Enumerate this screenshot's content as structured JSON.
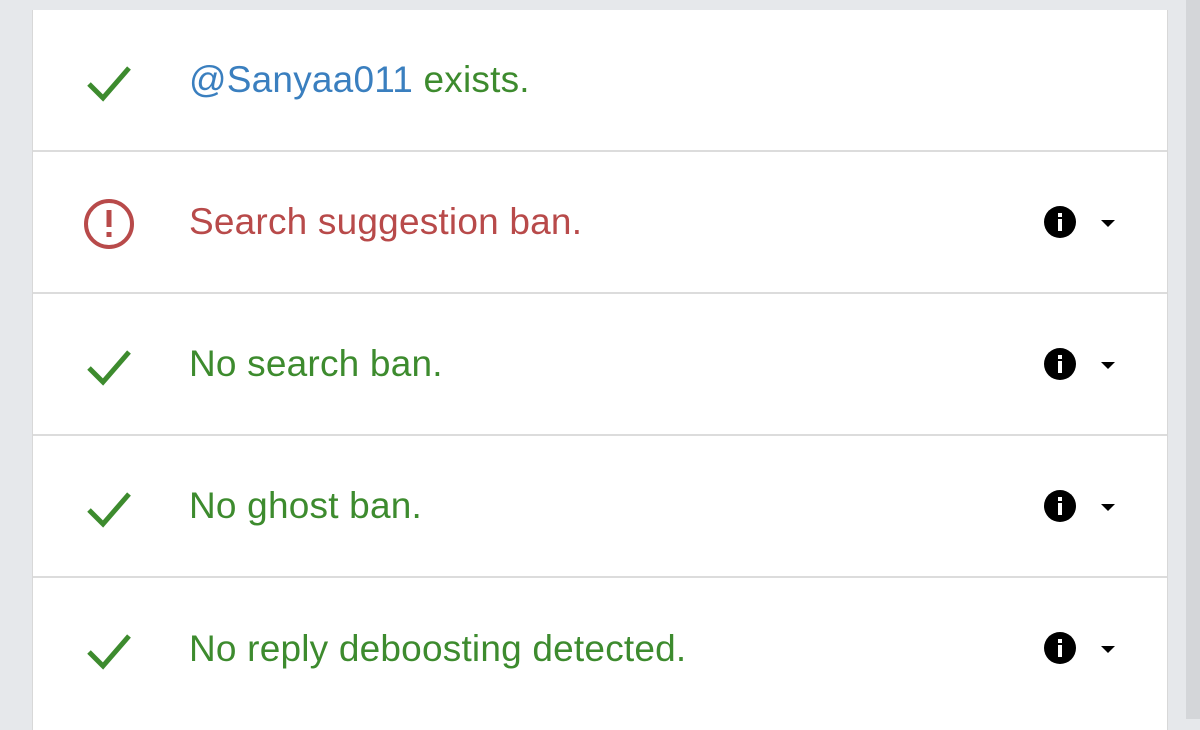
{
  "colors": {
    "ok": "#3d8b2e",
    "error": "#b84a4a",
    "handle": "#3a7fbf",
    "info_icon": "#000000",
    "background": "#e6e8eb"
  },
  "checks": [
    {
      "status": "ok",
      "icon": "check-icon",
      "handle": "@Sanyaa011",
      "text": " exists.",
      "has_details": false
    },
    {
      "status": "error",
      "icon": "alert-circle-icon",
      "text": "Search suggestion ban.",
      "has_details": true
    },
    {
      "status": "ok",
      "icon": "check-icon",
      "text": "No search ban.",
      "has_details": true
    },
    {
      "status": "ok",
      "icon": "check-icon",
      "text": "No ghost ban.",
      "has_details": true
    },
    {
      "status": "ok",
      "icon": "check-icon",
      "text": "No reply deboosting detected.",
      "has_details": true
    }
  ]
}
